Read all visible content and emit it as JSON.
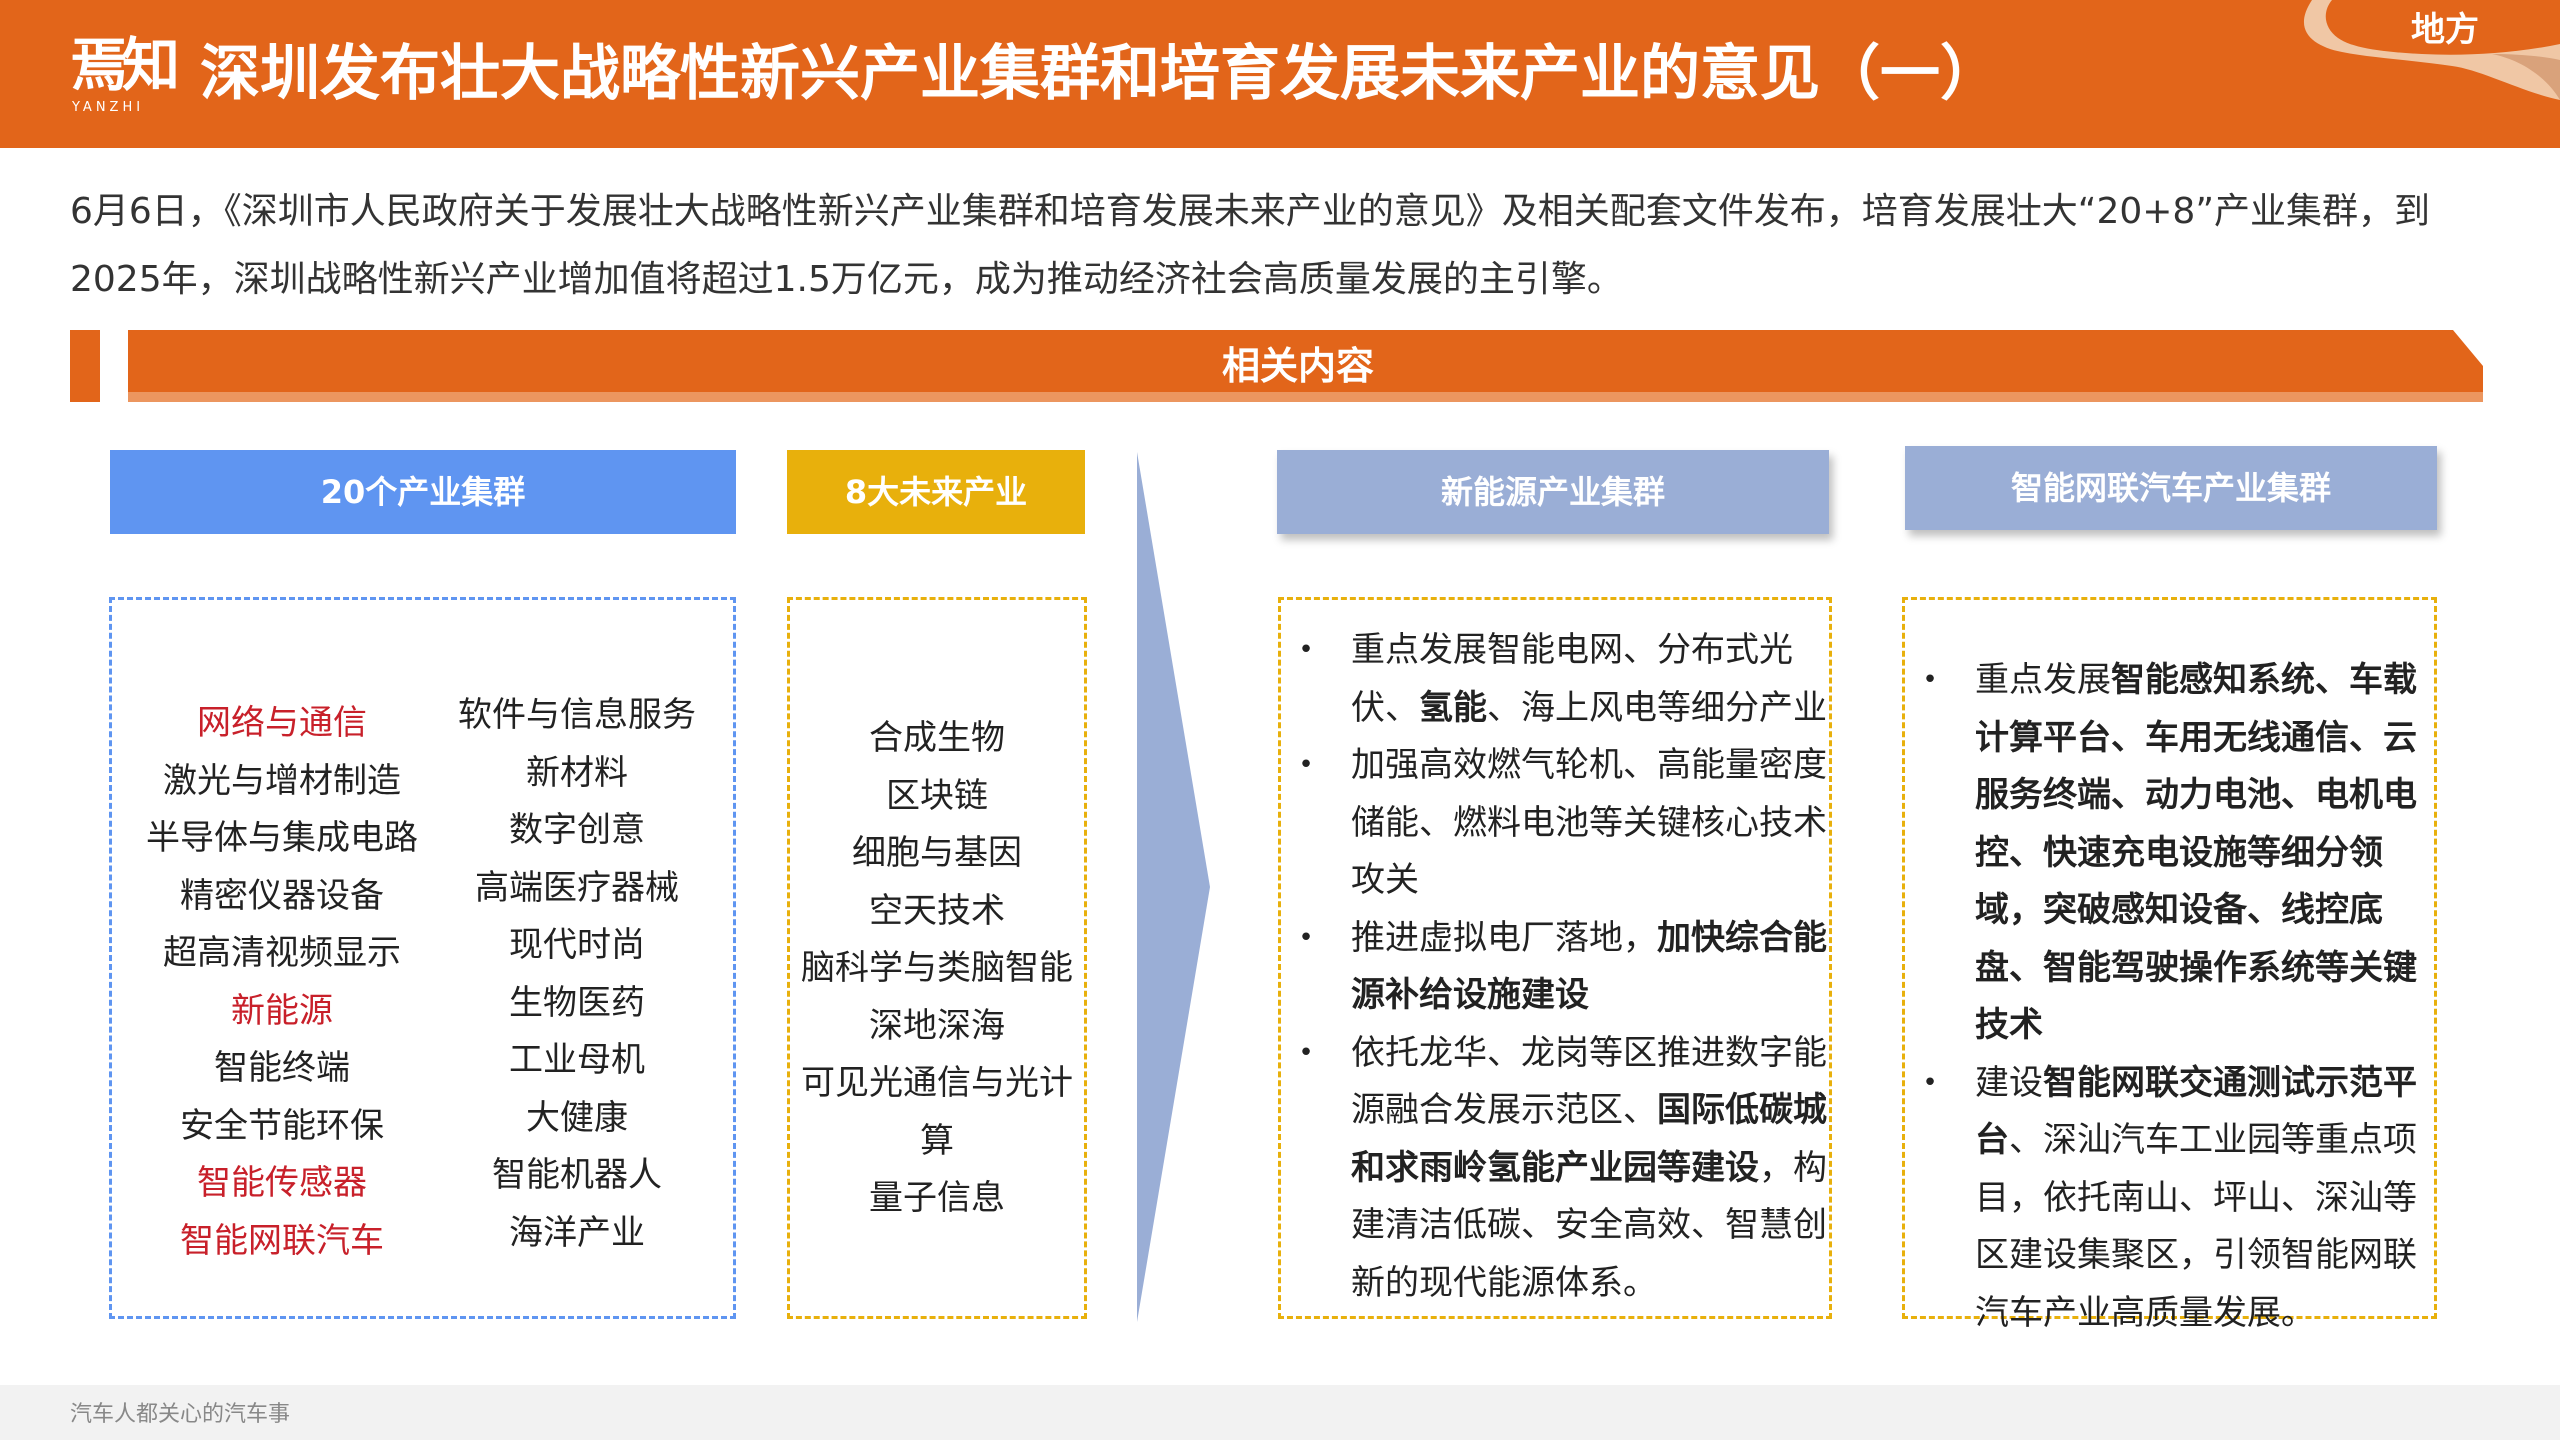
{
  "header": {
    "logo_cn": "焉知",
    "logo_en": "YANZHI",
    "title": "深圳发布壮大战略性新兴产业集群和培育发展未来产业的意见（一）",
    "tag": "地方"
  },
  "intro": "6月6日，《深圳市人民政府关于发展壮大战略性新兴产业集群和培育发展未来产业的意见》及相关配套文件发布，培育发展壮大“20+8”产业集群，到2025年，深圳战略性新兴产业增加值将超过1.5万亿元，成为推动经济社会高质量发展的主引擎。",
  "section_title": "相关内容",
  "clusters": {
    "title": "20个产业集群",
    "col1": [
      {
        "label": "网络与通信",
        "highlight": true
      },
      {
        "label": "激光与增材制造",
        "highlight": false
      },
      {
        "label": "半导体与集成电路",
        "highlight": false
      },
      {
        "label": "精密仪器设备",
        "highlight": false
      },
      {
        "label": "超高清视频显示",
        "highlight": false
      },
      {
        "label": "新能源",
        "highlight": true
      },
      {
        "label": "智能终端",
        "highlight": false
      },
      {
        "label": "安全节能环保",
        "highlight": false
      },
      {
        "label": "智能传感器",
        "highlight": true
      },
      {
        "label": "智能网联汽车",
        "highlight": true
      }
    ],
    "col2": [
      "软件与信息服务",
      "新材料",
      "数字创意",
      "高端医疗器械",
      "现代时尚",
      "生物医药",
      "工业母机",
      "大健康",
      "智能机器人",
      "海洋产业"
    ]
  },
  "future": {
    "title": "8大未来产业",
    "items": [
      "合成生物",
      "区块链",
      "细胞与基因",
      "空天技术",
      "脑科学与类脑智能",
      "深地深海",
      "可见光通信与光计算",
      "量子信息"
    ]
  },
  "new_energy": {
    "title": "新能源产业集群",
    "bullet": "•",
    "items": [
      [
        {
          "t": "重点发展智能电网、分布式光伏、"
        },
        {
          "t": "氢能",
          "b": true
        },
        {
          "t": "、海上风电等细分产业"
        }
      ],
      [
        {
          "t": "加强高效燃气轮机、高能量密度储能、燃料电池等关键核心技术攻关"
        }
      ],
      [
        {
          "t": "推进虚拟电厂落地，"
        },
        {
          "t": "加快综合能源补给设施建设",
          "b": true
        }
      ],
      [
        {
          "t": "依托龙华、龙岗等区推进数字能源融合发展示范区、"
        },
        {
          "t": "国际低碳城和求雨岭氢能产业园等建设",
          "b": true
        },
        {
          "t": "，构建清洁低碳、安全高效、智慧创新的现代能源体系。"
        }
      ]
    ]
  },
  "icv": {
    "title": "智能网联汽车产业集群",
    "bullet": "•",
    "items": [
      [
        {
          "t": "重点发展"
        },
        {
          "t": "智能感知系统、车载计算平台、车用无线通信、云服务终端、动力电池、电机电控、快速充电设施等细分领域，突破感知设备、线控底盘、智能驾驶操作系统等关键技术",
          "b": true
        }
      ],
      [
        {
          "t": "建设"
        },
        {
          "t": "智能网联交通测试示范平台",
          "b": true
        },
        {
          "t": "、深汕汽车工业园等重点项目，依托南山、坪山、深汕等区建设集聚区，引领智能网联汽车产业高质量发展。"
        }
      ]
    ]
  },
  "footer": "汽车人都关心的汽车事",
  "colors": {
    "brand_orange": "#e2651a",
    "cluster_blue": "#5f95f1",
    "future_gold": "#e8b00c",
    "panel_lavender": "#9aaed6",
    "highlight_red": "#c8202a"
  }
}
